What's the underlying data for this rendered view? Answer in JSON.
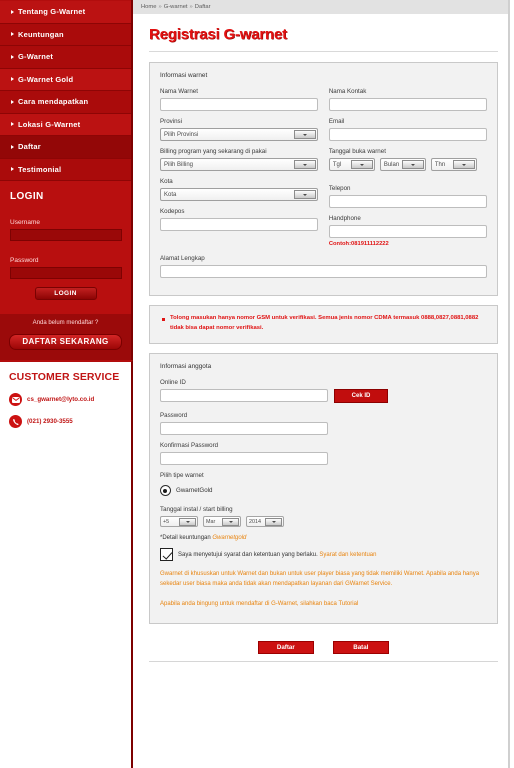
{
  "sidebar": {
    "nav_items": [
      {
        "label": "Tentang G-Warnet",
        "active": false
      },
      {
        "label": "Keuntungan",
        "active": false
      },
      {
        "label": "G-Warnet",
        "active": false
      },
      {
        "label": "G-Warnet Gold",
        "active": false
      },
      {
        "label": "Cara mendapatkan",
        "active": false
      },
      {
        "label": "Lokasi G-Warnet",
        "active": false
      },
      {
        "label": "Daftar",
        "active": true
      },
      {
        "label": "Testimonial",
        "active": false
      }
    ],
    "login": {
      "title": "LOGIN",
      "username_label": "Username",
      "password_label": "Password",
      "button_label": "LOGIN",
      "username_value": "",
      "password_value": ""
    },
    "register": {
      "question": "Anda belum mendaftar ?",
      "button_label": "DAFTAR SEKARANG"
    },
    "customer_service": {
      "title": "CUSTOMER SERVICE",
      "email": "cs_gwarnet@lyto.co.id",
      "phone": "(021) 2930-3555"
    }
  },
  "breadcrumb": {
    "items": [
      "Home",
      "G-warnet",
      "Daftar"
    ],
    "separator": "»"
  },
  "page": {
    "title": "Registrasi G-warnet"
  },
  "warnet_panel": {
    "heading": "Informasi warnet",
    "nama_warnet_label": "Nama Warnet",
    "nama_warnet_value": "",
    "nama_kontak_label": "Nama Kontak",
    "nama_kontak_value": "",
    "provinsi_label": "Provinsi",
    "provinsi_value": "Pilih Provinsi",
    "email_label": "Email",
    "email_value": "",
    "billing_label": "Billing program yang sekarang di pakai",
    "billing_value": "Pilih Billing",
    "tanggal_buka_label": "Tanggal buka warnet",
    "tanggal_buka_day": "Tgl",
    "tanggal_buka_month": "Bulan",
    "tanggal_buka_year": "Thn",
    "kota_label": "Kota",
    "kota_value": "Kota",
    "telepon_label": "Telepon",
    "telepon_value": "",
    "kodepos_label": "Kodepos",
    "kodepos_value": "",
    "handphone_label": "Handphone",
    "handphone_value": "",
    "handphone_hint": "Contoh:081911112222",
    "alamat_label": "Alamat Lengkap",
    "alamat_value": ""
  },
  "notice": {
    "items": [
      "Tolong masukan hanya nomor GSM untuk verifikasi. Semua jenis nomor CDMA termasuk 0888,0827,0881,0882 tidak bisa dapat nomor verifikasi."
    ]
  },
  "anggota_panel": {
    "heading": "Informasi anggota",
    "online_id_label": "Online ID",
    "online_id_value": "",
    "cek_id_label": "Cek ID",
    "password_label": "Password",
    "password_value": "",
    "konfirmasi_label": "Konfirmasi Password",
    "konfirmasi_value": "",
    "tipe_warnet_label": "Pilih tipe warnet",
    "tipe_option": "GwarnetGold",
    "tanggal_instal_label": "Tanggal instal / start billing",
    "tanggal_instal_day": "+5",
    "tanggal_instal_month": "Mar",
    "tanggal_instal_year": "2014",
    "detail_prefix": "*Detail keuntungan ",
    "detail_link": "Gwarnetgold",
    "agree_text": "Saya menyetujui syarat dan ketentuan yang berlaku. ",
    "agree_link": "Syarat dan ketentuan",
    "agree_checked": true,
    "info_paragraph": "Gwarnet di khususkan untuk Warnet dan bukan untuk user player biasa yang tidak memiliki Warnet. Apabila anda hanya sekedar user biasa maka anda tidak akan mendapatkan layanan dari GWarnet Service.",
    "tutorial_prefix": "Apabila anda bingung untuk mendaftar di G-Warnet, silahkan baca ",
    "tutorial_link": "Tutorial"
  },
  "actions": {
    "submit_label": "Daftar",
    "cancel_label": "Batal"
  },
  "colors": {
    "brand_red": "#b20d0d",
    "accent_red": "#e21111",
    "orange": "#e8830d"
  }
}
